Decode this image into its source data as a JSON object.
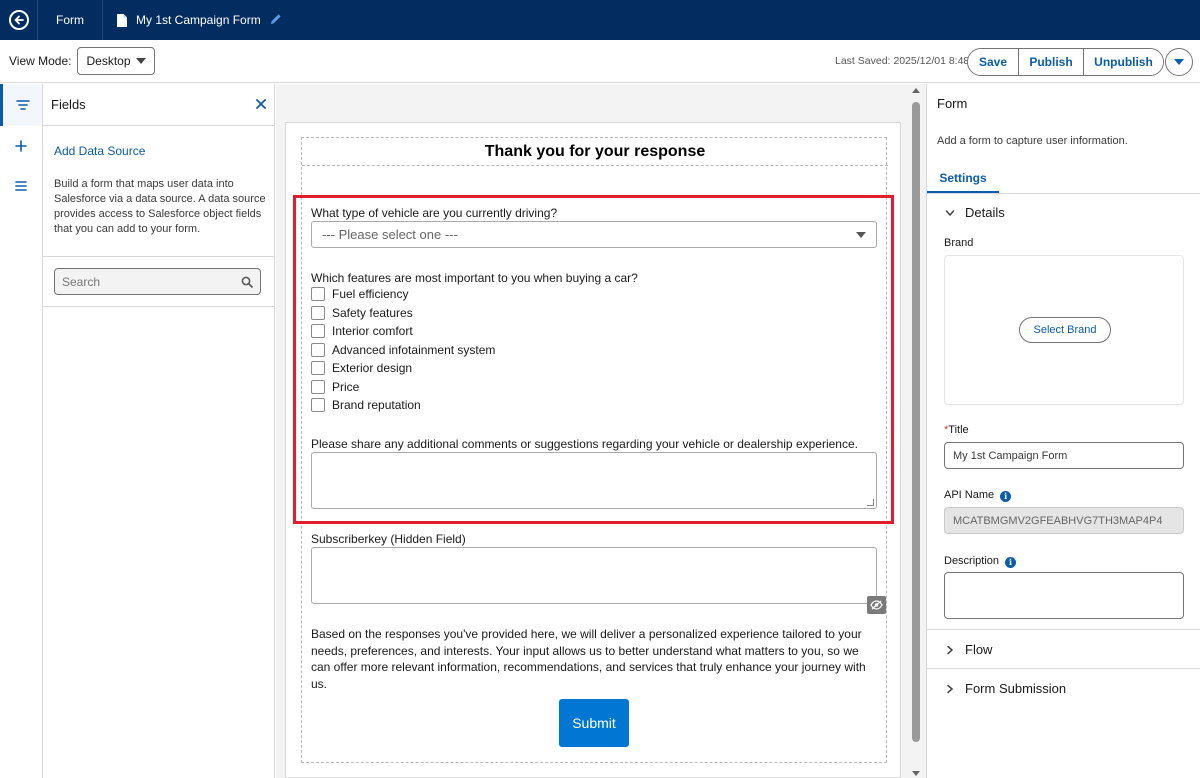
{
  "topbar": {
    "app_label": "Form",
    "document_title": "My 1st Campaign Form"
  },
  "toolbar": {
    "view_mode_label": "View Mode:",
    "view_mode_value": "Desktop",
    "last_saved": "Last Saved: 2025/12/01 8:48",
    "save_label": "Save",
    "publish_label": "Publish",
    "unpublish_label": "Unpublish"
  },
  "fields_panel": {
    "title": "Fields",
    "add_data_source": "Add Data Source",
    "description": "Build a form that maps user data into Salesforce via a data source. A data source provides access to Salesforce object fields that you can add to your form.",
    "search_placeholder": "Search"
  },
  "form": {
    "heading": "Thank you for your response",
    "q1_label": "What type of vehicle are you currently driving?",
    "q1_placeholder": "--- Please select one ---",
    "q2_label": "Which features are most important to you when buying a car?",
    "q2_options": [
      "Fuel efficiency",
      "Safety features",
      "Interior comfort",
      "Advanced infotainment system",
      "Exterior design",
      "Price",
      "Brand reputation"
    ],
    "q3_label": "Please share any additional comments or suggestions regarding your vehicle or dealership experience.",
    "hidden_field_label": "Subscriberkey (Hidden Field)",
    "closing_text": "Based on the responses you've provided here, we will deliver a personalized experience tailored to your needs, preferences, and interests. Your input allows us to better understand what matters to you, so we can offer more relevant information, recommendations, and services that truly enhance your journey with us.",
    "submit_label": "Submit"
  },
  "properties": {
    "title": "Form",
    "description": "Add a form to capture user information.",
    "tab_settings": "Settings",
    "details_label": "Details",
    "brand_label": "Brand",
    "select_brand_label": "Select Brand",
    "required_mark": "*",
    "title_label": "Title",
    "title_value": "My 1st Campaign Form",
    "api_name_label": "API Name",
    "api_name_value": "MCATBMGMV2GFEABHVG7TH3MAP4P4",
    "description_label": "Description",
    "flow_label": "Flow",
    "form_submission_label": "Form Submission"
  },
  "colors": {
    "nav_bg": "#032d60",
    "brand_blue": "#0b5cab",
    "submit_blue": "#0176d3",
    "highlight_red": "#e01e2e"
  }
}
